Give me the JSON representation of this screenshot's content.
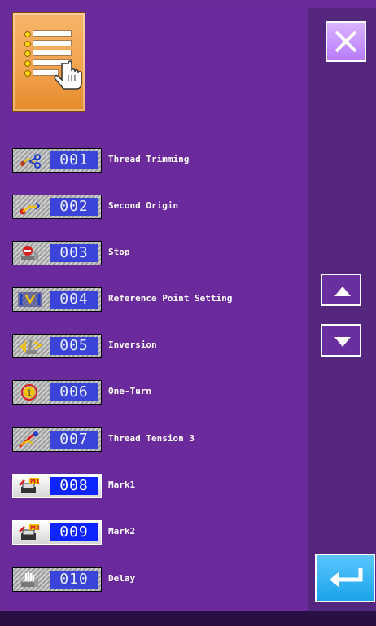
{
  "menu": {
    "icon": "list-menu-hand-icon"
  },
  "buttons": {
    "close": {
      "icon": "close-x-icon"
    },
    "scroll_up": {
      "icon": "triangle-up-icon"
    },
    "scroll_down": {
      "icon": "triangle-down-icon"
    },
    "enter": {
      "icon": "enter-arrow-icon"
    }
  },
  "commands": [
    {
      "code": "001",
      "label": "Thread Trimming",
      "icon": "thread-trim-icon"
    },
    {
      "code": "002",
      "label": "Second Origin",
      "icon": "second-origin-icon"
    },
    {
      "code": "003",
      "label": "Stop",
      "icon": "stop-icon"
    },
    {
      "code": "004",
      "label": "Reference Point Setting",
      "icon": "reference-point-icon"
    },
    {
      "code": "005",
      "label": "Inversion",
      "icon": "inversion-icon"
    },
    {
      "code": "006",
      "label": "One-Turn",
      "icon": "one-turn-icon"
    },
    {
      "code": "007",
      "label": "Thread Tension 3",
      "icon": "thread-tension-icon"
    },
    {
      "code": "008",
      "label": "Mark1",
      "icon": "mark1-icon"
    },
    {
      "code": "009",
      "label": "Mark2",
      "icon": "mark2-icon"
    },
    {
      "code": "010",
      "label": "Delay",
      "icon": "delay-icon"
    }
  ],
  "colors": {
    "background": "#6b2a9c",
    "side_panel": "#55267e",
    "code_box": "#3b44d8",
    "active_code_box": "#0d24ff",
    "menu_tile": "#f2a24c",
    "close_button": "#c58bff",
    "enter_button": "#29a9ef"
  }
}
